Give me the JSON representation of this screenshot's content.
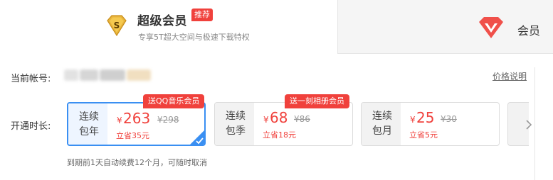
{
  "tabs": {
    "svip": {
      "title": "超级会员",
      "badge": "推荐",
      "desc": "专享5T超大空间与极速下载特权",
      "icon": "svip-s-badge-icon",
      "icon_letter": "S",
      "icon_color": "#e8b43c"
    },
    "vip": {
      "title": "会员",
      "icon": "vip-heart-icon",
      "icon_color": "#f0504a"
    }
  },
  "account": {
    "label": "当前帐号:"
  },
  "price_note": "价格说明",
  "duration": {
    "label": "开通时长:"
  },
  "plans": [
    {
      "period_line1": "连续",
      "period_line2": "包年",
      "currency": "¥",
      "price": "263",
      "original": "¥298",
      "save": "立省35元",
      "promo": "送QQ音乐会员",
      "selected": true
    },
    {
      "period_line1": "连续",
      "period_line2": "包季",
      "currency": "¥",
      "price": "68",
      "original": "¥86",
      "save": "立省18元",
      "promo": "送一刻相册会员",
      "selected": false
    },
    {
      "period_line1": "连续",
      "period_line2": "包月",
      "currency": "¥",
      "price": "25",
      "original": "¥30",
      "save": "立省5元",
      "promo": "",
      "selected": false
    }
  ],
  "footnote": "到期前1天自动续费12个月，可随时取消",
  "colors": {
    "accent_red": "#f0413c",
    "select_blue": "#3a8ff2"
  }
}
